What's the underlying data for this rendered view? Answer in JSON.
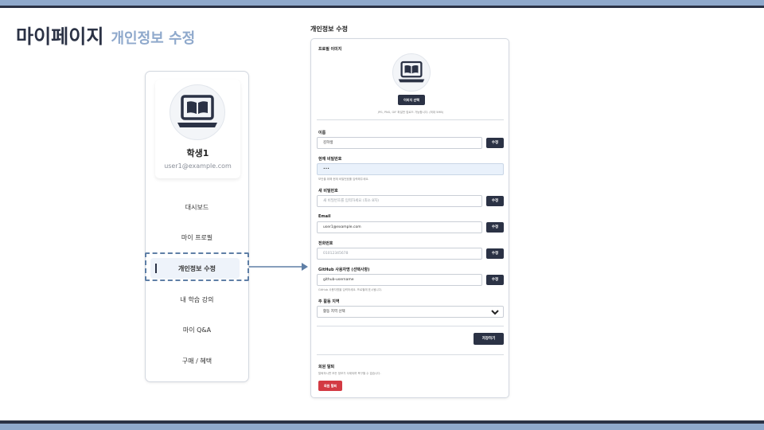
{
  "slide": {
    "title": "마이페이지",
    "subtitle": "개인정보 수정"
  },
  "sidebar": {
    "user_name": "학생1",
    "user_email": "user1@example.com",
    "menu": [
      {
        "label": "대시보드",
        "active": false
      },
      {
        "label": "마이 프로필",
        "active": false
      },
      {
        "label": "개인정보 수정",
        "active": true
      },
      {
        "label": "내 학습 강의",
        "active": false
      },
      {
        "label": "마이 Q&A",
        "active": false
      },
      {
        "label": "구매 / 혜택",
        "active": false
      }
    ]
  },
  "form": {
    "heading": "개인정보 수정",
    "profile_image_label": "프로필 이미지",
    "image_button": "이미지 선택",
    "image_hint": "JPG, PNG, GIF 파일만 업로드 가능합니다. (최대 5MB)",
    "name_label": "이름",
    "name_value": "김학생",
    "current_password_label": "현재 비밀번호",
    "current_password_value": "•••",
    "current_password_hint": "보안을 위해 현재 비밀번호를 입력해주세요.",
    "new_password_label": "새 비밀번호",
    "new_password_placeholder": "새 비밀번호를 입력하세요 (최소 8자)",
    "email_label": "Email",
    "email_value": "user1@example.com",
    "phone_label": "전화번호",
    "phone_placeholder": "01012345678",
    "github_label": "GitHub 사용자명 (선택사항)",
    "github_value": "github-username",
    "github_hint": "GitHub 사용자명을 입력하세요. 프로필에 표시됩니다.",
    "region_label": "주 활동 지역",
    "region_value": "활동 지역 선택",
    "edit_button": "수정",
    "save_button": "저장하기",
    "withdraw_label": "회원 탈퇴",
    "withdraw_hint": "탈퇴하시면 모든 정보가 삭제되며 복구할 수 없습니다.",
    "withdraw_button": "회원 탈퇴"
  },
  "colors": {
    "primary": "#2b3245",
    "accent": "#8fa9cc",
    "danger": "#d33a43",
    "active_bg": "#eef3fa"
  },
  "icons": {
    "avatar": "laptop-book-icon",
    "dropdown": "chevron-down-icon",
    "connector": "arrow-right-icon"
  }
}
